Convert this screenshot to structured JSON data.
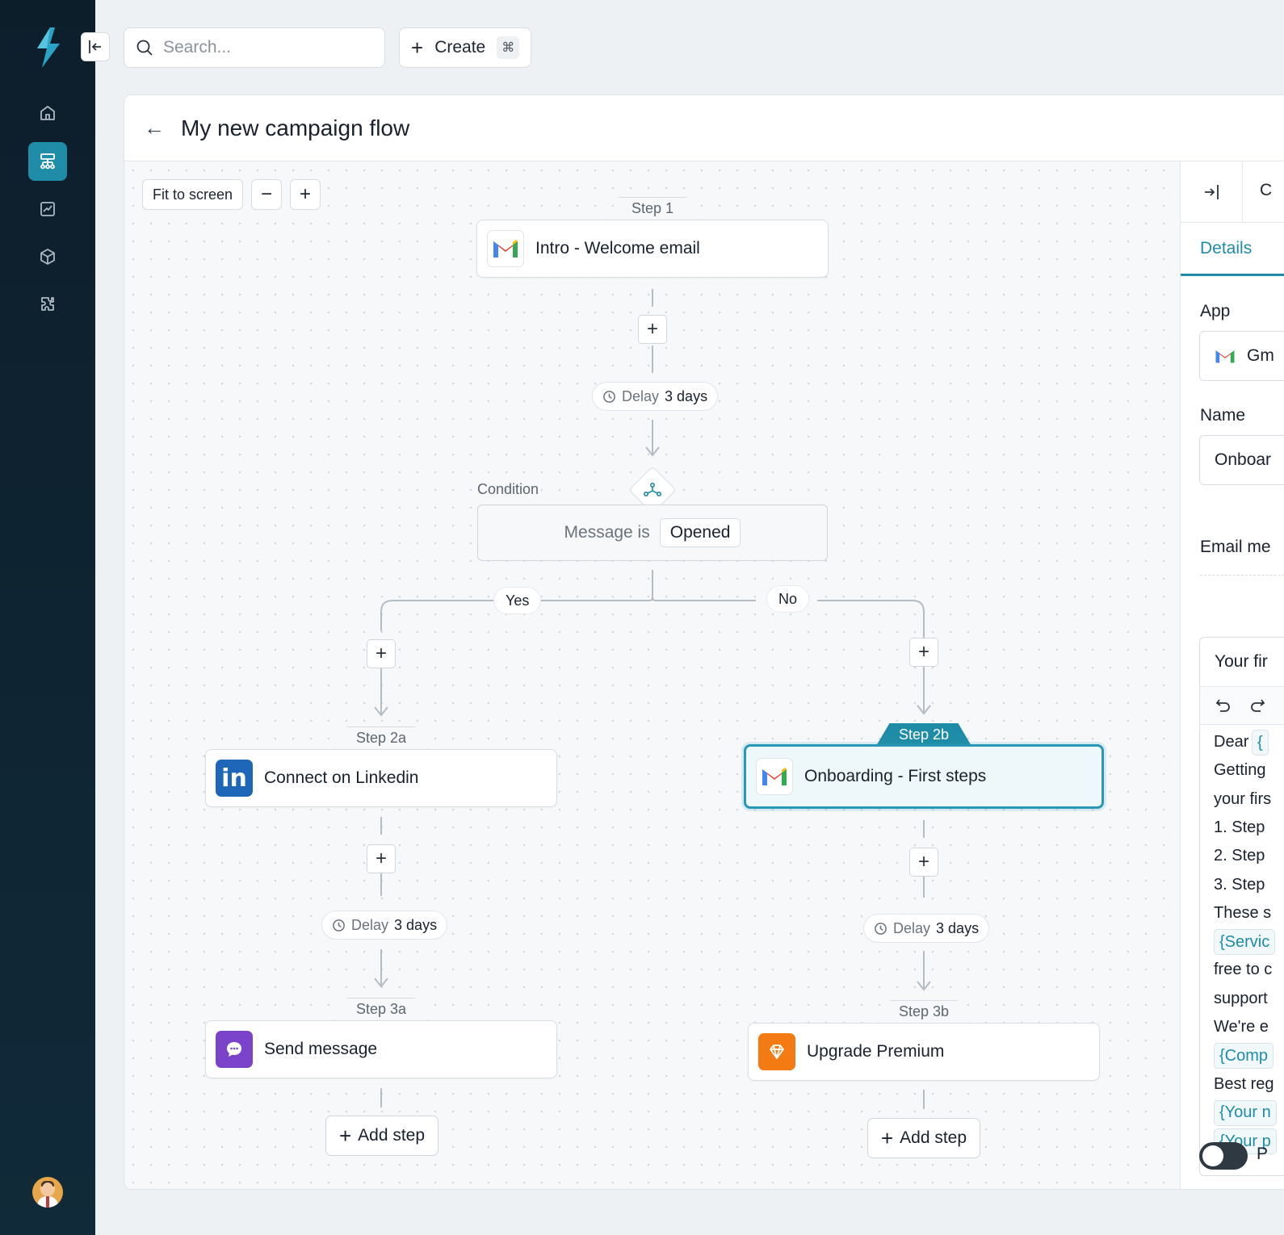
{
  "topbar": {
    "search_placeholder": "Search...",
    "create_label": "Create",
    "create_shortcut": "⌘"
  },
  "sidebar": {
    "items": [
      {
        "name": "home",
        "active": false
      },
      {
        "name": "flows",
        "active": true
      },
      {
        "name": "analytics",
        "active": false
      },
      {
        "name": "packages",
        "active": false
      },
      {
        "name": "integrations",
        "active": false
      }
    ]
  },
  "flow": {
    "title": "My new campaign flow",
    "tools": {
      "fit_label": "Fit to screen",
      "zoom_out": "−",
      "zoom_in": "+"
    },
    "step1": {
      "tab": "Step 1",
      "label": "Intro - Welcome email",
      "app": "gmail"
    },
    "delay1": {
      "label": "Delay",
      "value": "3 days"
    },
    "condition": {
      "label": "Condition",
      "text": "Message is",
      "value": "Opened"
    },
    "branches": {
      "yes": "Yes",
      "no": "No"
    },
    "step2a": {
      "tab": "Step 2a",
      "label": "Connect on Linkedin",
      "app": "linkedin"
    },
    "step2b": {
      "tab": "Step 2b",
      "label": "Onboarding - First steps",
      "app": "gmail"
    },
    "delay2a": {
      "label": "Delay",
      "value": "3 days"
    },
    "delay2b": {
      "label": "Delay",
      "value": "3 days"
    },
    "step3a": {
      "tab": "Step 3a",
      "label": "Send message",
      "app": "message"
    },
    "step3b": {
      "tab": "Step 3b",
      "label": "Upgrade Premium",
      "app": "premium"
    },
    "add_step_label": "Add step",
    "plus": "+"
  },
  "details": {
    "cut_text": "C",
    "tab": "Details",
    "app_label": "App",
    "app_value": "Gm",
    "name_label": "Name",
    "name_value": "Onboar",
    "email_label": "Email me",
    "subject": "Your fir",
    "body_lines": [
      {
        "type": "text",
        "text": "Dear"
      },
      {
        "type": "text",
        "text": "Getting"
      },
      {
        "type": "text",
        "text": "your firs"
      },
      {
        "type": "text",
        "text": " 1. Step"
      },
      {
        "type": "text",
        "text": " 2. Step"
      },
      {
        "type": "text",
        "text": " 3. Step"
      },
      {
        "type": "text",
        "text": "These s"
      },
      {
        "type": "var",
        "text": "{Servic"
      },
      {
        "type": "text",
        "text": "free to c"
      },
      {
        "type": "text",
        "text": "support"
      },
      {
        "type": "text",
        "text": "We're e"
      },
      {
        "type": "var",
        "text": "{Comp"
      },
      {
        "type": "text",
        "text": "Best reg"
      },
      {
        "type": "var",
        "text": "{Your n"
      },
      {
        "type": "var",
        "text": "{Your p"
      }
    ],
    "dear_var": "{",
    "toggle_label": "P"
  },
  "colors": {
    "accent": "#1e8ca6",
    "sidebar_bg": "#0d1e2b",
    "linkedin": "#1d66b8",
    "message": "#7b43c9",
    "premium": "#f47b14"
  }
}
